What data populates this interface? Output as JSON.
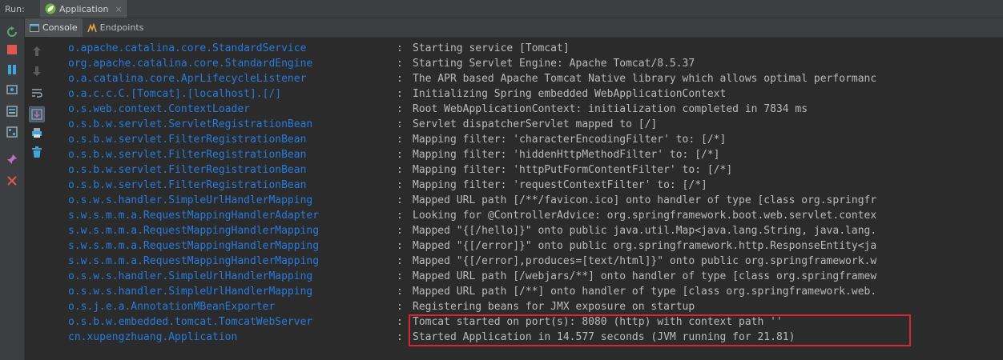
{
  "run_bar": {
    "label": "Run:",
    "tab_label": "Application",
    "close_glyph": "×"
  },
  "sub_tabs": [
    {
      "label": "Console",
      "active": true
    },
    {
      "label": "Endpoints",
      "active": false
    }
  ],
  "left_toolbar_icons": [
    "rerun-icon",
    "stop-icon",
    "pause-icon",
    "dump-threads-icon",
    "restore-layout-icon",
    "pin-icon",
    "close-icon"
  ],
  "console_toolbar_icons": [
    "scroll-up-icon",
    "scroll-down-icon",
    "soft-wrap-icon",
    "scroll-to-end-icon",
    "print-icon",
    "clear-all-icon"
  ],
  "colors": {
    "logger": "#287bde",
    "text": "#bbbbbb",
    "background": "#2b2b2b",
    "highlight_border": "#d9262c"
  },
  "log_lines": [
    {
      "logger": "o.apache.catalina.core.StandardService",
      "message": "Starting service [Tomcat]"
    },
    {
      "logger": "org.apache.catalina.core.StandardEngine",
      "message": "Starting Servlet Engine: Apache Tomcat/8.5.37"
    },
    {
      "logger": "o.a.catalina.core.AprLifecycleListener",
      "message": "The APR based Apache Tomcat Native library which allows optimal performanc"
    },
    {
      "logger": "o.a.c.c.C.[Tomcat].[localhost].[/]",
      "message": "Initializing Spring embedded WebApplicationContext"
    },
    {
      "logger": "o.s.web.context.ContextLoader",
      "message": "Root WebApplicationContext: initialization completed in 7834 ms"
    },
    {
      "logger": "o.s.b.w.servlet.ServletRegistrationBean",
      "message": "Servlet dispatcherServlet mapped to [/]"
    },
    {
      "logger": "o.s.b.w.servlet.FilterRegistrationBean",
      "message": "Mapping filter: 'characterEncodingFilter' to: [/*]"
    },
    {
      "logger": "o.s.b.w.servlet.FilterRegistrationBean",
      "message": "Mapping filter: 'hiddenHttpMethodFilter' to: [/*]"
    },
    {
      "logger": "o.s.b.w.servlet.FilterRegistrationBean",
      "message": "Mapping filter: 'httpPutFormContentFilter' to: [/*]"
    },
    {
      "logger": "o.s.b.w.servlet.FilterRegistrationBean",
      "message": "Mapping filter: 'requestContextFilter' to: [/*]"
    },
    {
      "logger": "o.s.w.s.handler.SimpleUrlHandlerMapping",
      "message": "Mapped URL path [/**/favicon.ico] onto handler of type [class org.springfr"
    },
    {
      "logger": "s.w.s.m.m.a.RequestMappingHandlerAdapter",
      "message": "Looking for @ControllerAdvice: org.springframework.boot.web.servlet.contex"
    },
    {
      "logger": "s.w.s.m.m.a.RequestMappingHandlerMapping",
      "message": "Mapped \"{[/hello]}\" onto public java.util.Map<java.lang.String, java.lang."
    },
    {
      "logger": "s.w.s.m.m.a.RequestMappingHandlerMapping",
      "message": "Mapped \"{[/error]}\" onto public org.springframework.http.ResponseEntity<ja"
    },
    {
      "logger": "s.w.s.m.m.a.RequestMappingHandlerMapping",
      "message": "Mapped \"{[/error],produces=[text/html]}\" onto public org.springframework.w"
    },
    {
      "logger": "o.s.w.s.handler.SimpleUrlHandlerMapping",
      "message": "Mapped URL path [/webjars/**] onto handler of type [class org.springframew"
    },
    {
      "logger": "o.s.w.s.handler.SimpleUrlHandlerMapping",
      "message": "Mapped URL path [/**] onto handler of type [class org.springframework.web."
    },
    {
      "logger": "o.s.j.e.a.AnnotationMBeanExporter",
      "message": "Registering beans for JMX exposure on startup"
    },
    {
      "logger": "o.s.b.w.embedded.tomcat.TomcatWebServer",
      "message": "Tomcat started on port(s): 8080 (http) with context path ''"
    },
    {
      "logger": "cn.xupengzhuang.Application",
      "message": "Started Application in 14.577 seconds (JVM running for 21.81)"
    }
  ],
  "separator": ":"
}
